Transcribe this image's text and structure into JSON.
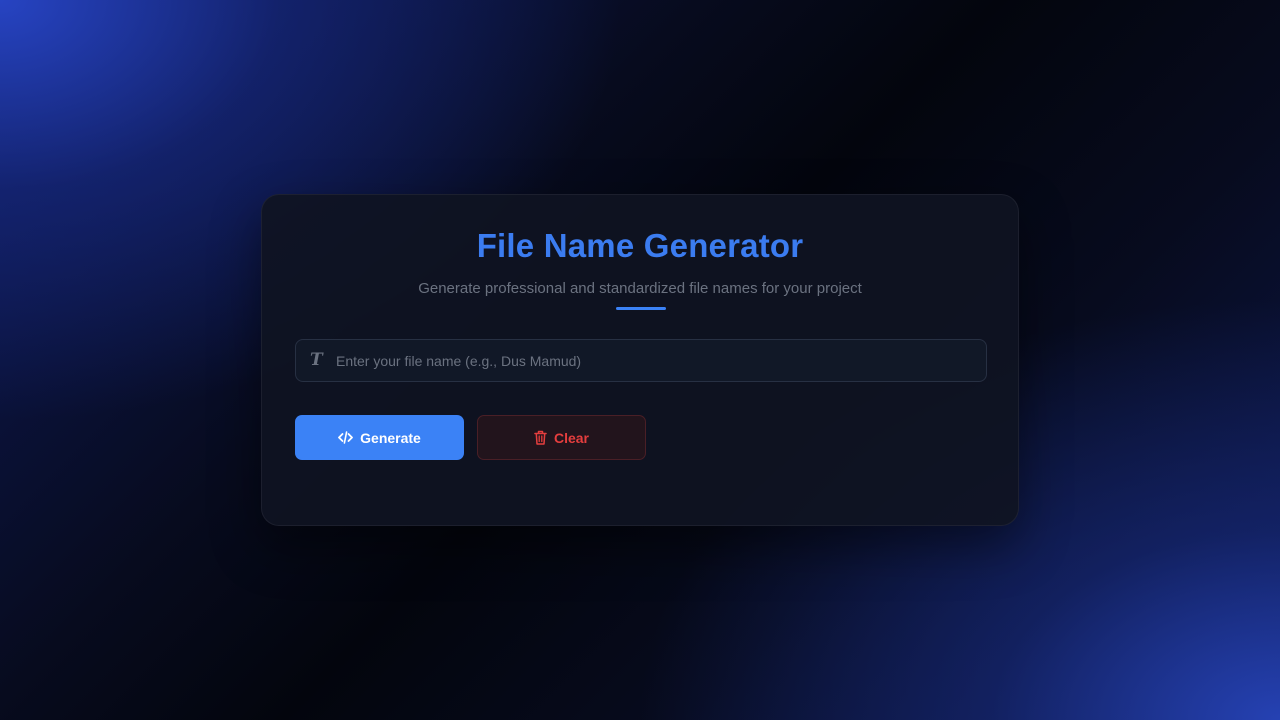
{
  "header": {
    "title": "File Name Generator",
    "subtitle": "Generate professional and standardized file names for your project"
  },
  "input": {
    "icon": "text-format-icon",
    "icon_glyph": "T",
    "placeholder": "Enter your file name (e.g., Dus Mamud)",
    "value": ""
  },
  "buttons": {
    "generate": {
      "label": "Generate",
      "icon": "code-icon"
    },
    "clear": {
      "label": "Clear",
      "icon": "trash-icon"
    }
  },
  "colors": {
    "accent": "#3b82f6",
    "title": "#3b7cf0",
    "danger": "#e53e3e"
  }
}
